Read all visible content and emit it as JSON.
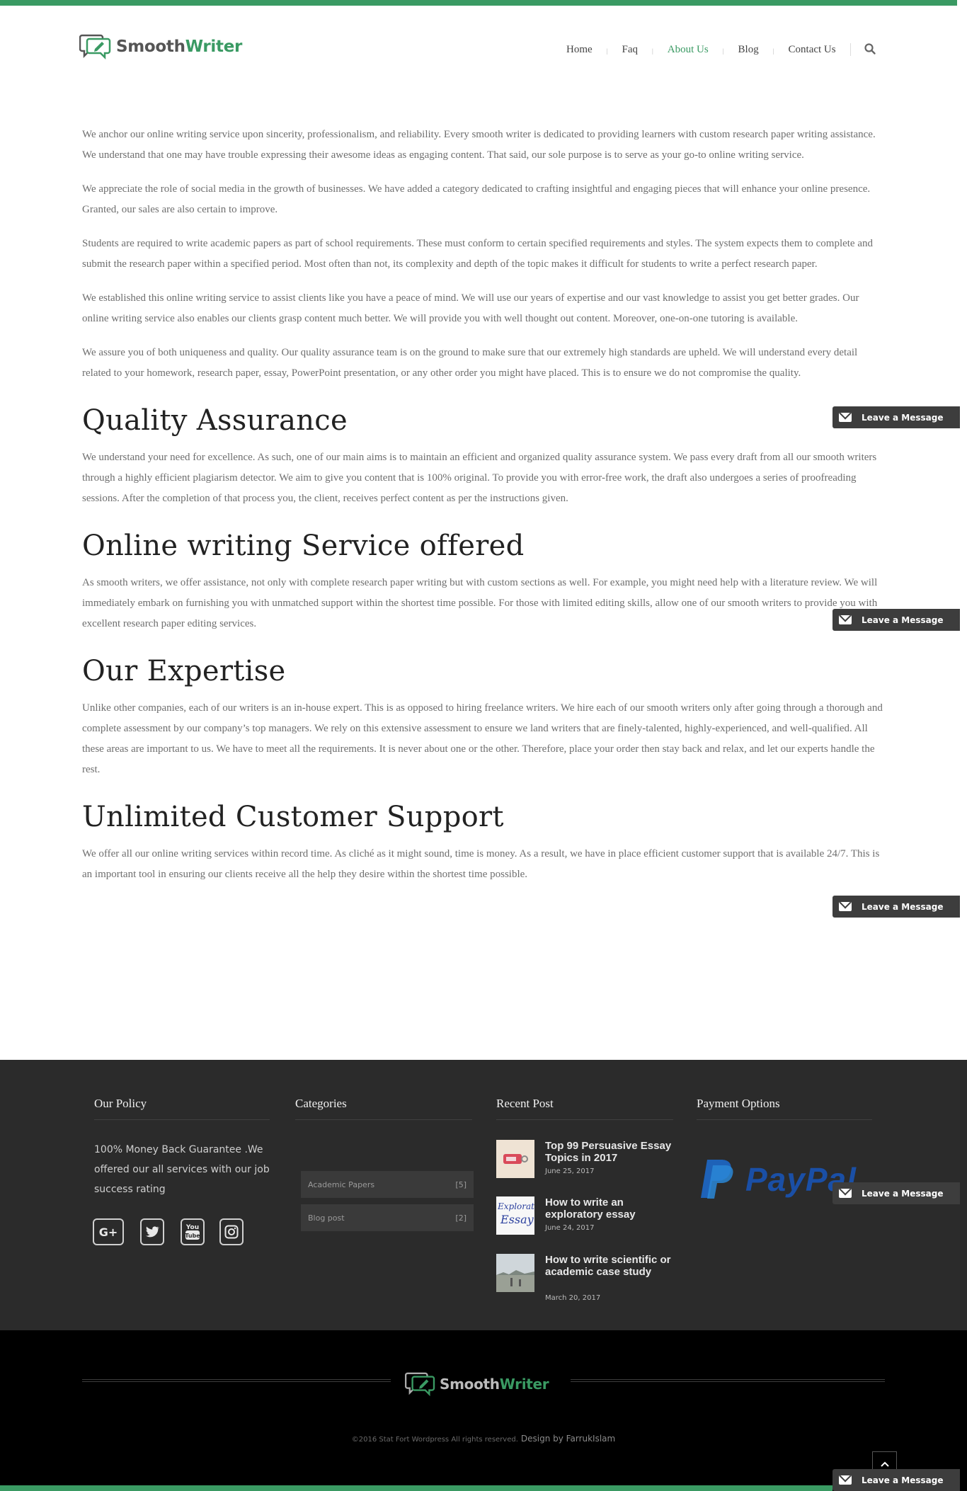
{
  "header": {
    "logo_part1": "Smooth",
    "logo_part2": "Writer",
    "nav": [
      {
        "label": "Home"
      },
      {
        "label": "Faq"
      },
      {
        "label": "About Us"
      },
      {
        "label": "Blog"
      },
      {
        "label": "Contact Us"
      }
    ],
    "search_icon": "search-icon"
  },
  "main": {
    "intro_paragraphs": [
      "We anchor our online writing service upon sincerity, professionalism, and reliability. Every smooth writer is dedicated to providing learners with custom research paper writing assistance. We understand that one may have trouble expressing their awesome ideas as engaging content. That said, our sole purpose is to serve as your go-to online writing service.",
      "We appreciate the role of social media in the growth of businesses. We have added a category dedicated to crafting insightful and engaging pieces that will enhance your online presence. Granted, our sales are also certain to improve.",
      "Students are required to write academic papers as part of school requirements. These must conform to certain specified requirements and styles. The system expects them to complete and submit the research paper within a specified period. Most often than not, its complexity and depth of the topic makes it difficult for students to write a perfect research paper.",
      "We established this online writing service to assist clients like you have a peace of mind. We will use our years of expertise and our vast knowledge to assist you get better grades. Our online writing service also enables our clients grasp content much better. We will provide you with well thought out content. Moreover, one-on-one tutoring is available.",
      "We assure you of both uniqueness and quality. Our quality assurance team is on the ground to make sure that our extremely high standards are upheld. We will understand every detail related to your homework, research paper, essay, PowerPoint presentation, or any other order you might have placed. This is to ensure we do not compromise the quality."
    ],
    "sections": [
      {
        "title": "Quality Assurance",
        "text": "We understand your need for excellence. As such, one of our main aims is to maintain an efficient and organized quality assurance system. We pass every draft from all our smooth writers through a highly efficient plagiarism detector. We aim to give you content that is 100% original. To provide you with error-free work, the draft also undergoes a series of proofreading sessions. After the completion of that process you, the client, receives perfect content as per the instructions given."
      },
      {
        "title": "Online writing Service offered",
        "text": "As smooth writers, we offer assistance, not only with complete research paper writing but with custom sections as well. For example, you might need help with a literature review. We will immediately embark on furnishing you with unmatched support within the shortest time possible. For those with limited editing skills, allow one of our smooth writers to provide you with excellent research paper editing services."
      },
      {
        "title": "Our Expertise",
        "text": "Unlike other companies, each of our writers is an in-house expert. This is as opposed to hiring freelance writers. We hire each of our smooth writers only after going through a thorough and complete assessment by our company’s top managers. We rely on this extensive assessment to ensure we land writers that are finely-talented, highly-experienced, and well-qualified. All these areas are important to us.  We have to meet all the requirements. It is never about one or the other. Therefore, place your order then stay back and relax, and let our experts handle the rest."
      },
      {
        "title": "Unlimited Customer Support",
        "text": "We offer all our online writing services within record time. As cliché as it might sound, time is money. As a result, we have in place efficient customer support that is available 24/7. This is an important tool in ensuring our clients receive all the help they desire within the shortest time possible."
      }
    ]
  },
  "leave_message": {
    "label": "Leave a Message"
  },
  "footer": {
    "policy": {
      "heading": "Our Policy",
      "text": "100% Money Back Guarantee .We offered our all services with our job success rating",
      "social": [
        "google-plus-icon",
        "twitter-icon",
        "youtube-icon",
        "instagram-icon"
      ],
      "youtube_top": "You",
      "youtube_bottom": "Tube"
    },
    "categories": {
      "heading": "Categories",
      "items": [
        {
          "label": "Academic Papers",
          "count": "[5]"
        },
        {
          "label": "Blog post",
          "count": "[2]"
        }
      ]
    },
    "recent": {
      "heading": "Recent Post",
      "posts": [
        {
          "title": "Top 99 Persuasive Essay Topics in 2017",
          "date": "June 25, 2017"
        },
        {
          "title": "How to write an exploratory essay",
          "date": "June 24, 2017"
        },
        {
          "title": "How to write scientific or academic case study",
          "date": "March 20, 2017"
        }
      ],
      "thumb2_text1": "Exploratory",
      "thumb2_text2": "Essay"
    },
    "payment": {
      "heading": "Payment Options",
      "logo_text": "PayPal"
    }
  },
  "bottom": {
    "logo_part1": "Smooth",
    "logo_part2": "Writer",
    "copyright": "©2016 Stat Fort Wordpress All rights reserved.",
    "design": "Design by FarrukIslam"
  },
  "colors": {
    "brand_green": "#3a9a63",
    "footer_bg": "#2b2b2b",
    "bottom_bg": "#000000",
    "paypal_blue": "#1e62b8"
  }
}
